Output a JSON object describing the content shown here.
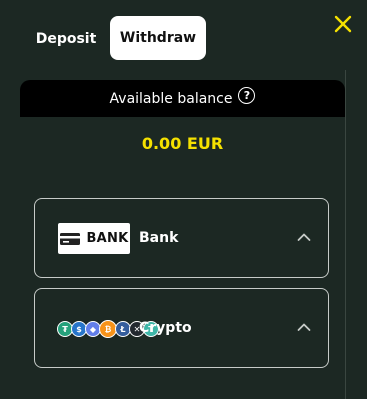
{
  "tabs": {
    "deposit": "Deposit",
    "withdraw": "Withdraw"
  },
  "icons": {
    "close": "close-icon",
    "help": "help-circle-icon",
    "chevron": "chevron-up-icon"
  },
  "balance": {
    "label": "Available balance",
    "amount": "0.00 EUR"
  },
  "methods": [
    {
      "label": "Bank",
      "logo_text": "BANK",
      "expanded": true
    },
    {
      "label": "Crypto",
      "coins": [
        "USDT",
        "USDC",
        "ETH",
        "BTC",
        "LTC",
        "XRP",
        "TRX"
      ],
      "expanded": true
    }
  ],
  "colors": {
    "background": "#1c2823",
    "accent": "#f5e100",
    "balance_bar": "#000000",
    "active_tab": "#ffffff"
  }
}
